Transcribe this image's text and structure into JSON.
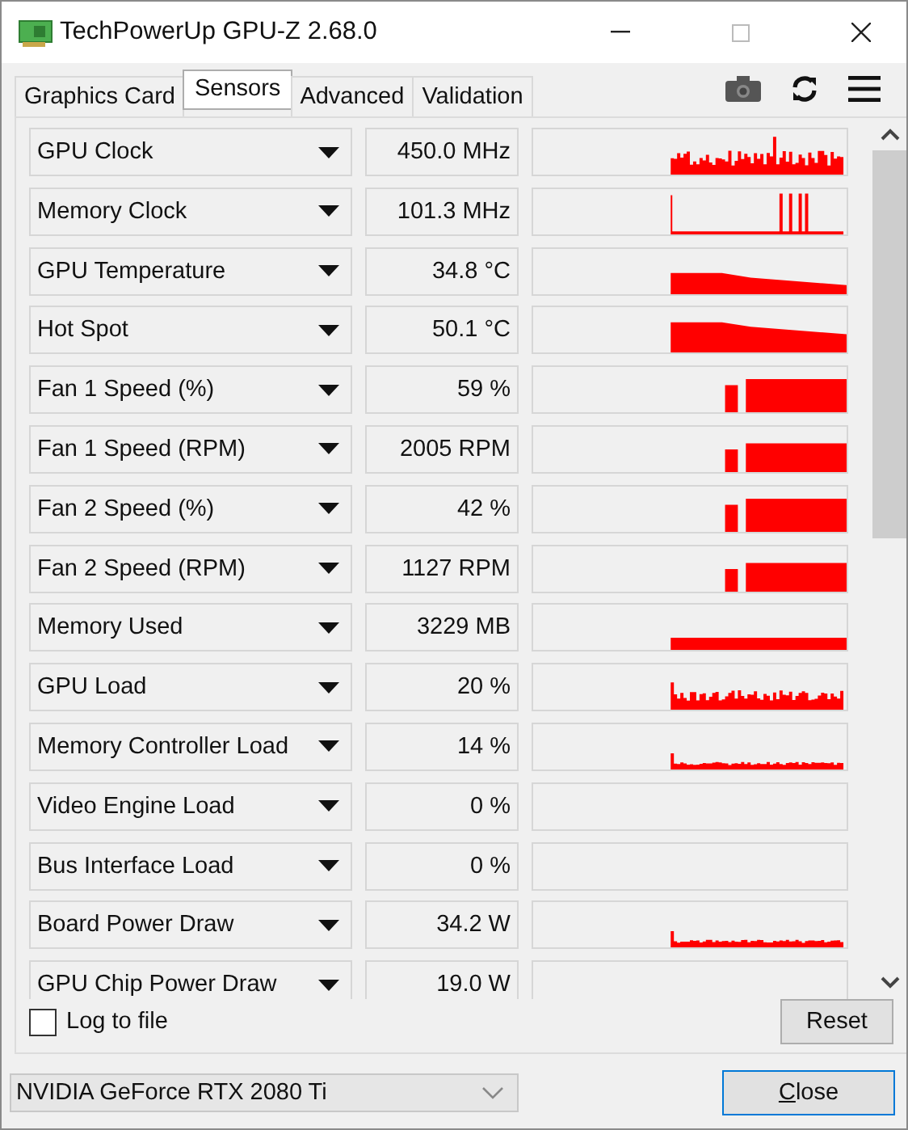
{
  "window": {
    "title": "TechPowerUp GPU-Z 2.68.0"
  },
  "tabs": [
    {
      "label": "Graphics Card",
      "selected": false
    },
    {
      "label": "Sensors",
      "selected": true
    },
    {
      "label": "Advanced",
      "selected": false
    },
    {
      "label": "Validation",
      "selected": false
    }
  ],
  "sensors": [
    {
      "name": "GPU Clock",
      "value": "450.0 MHz",
      "kind": "spiky"
    },
    {
      "name": "Memory Clock",
      "value": "101.3 MHz",
      "kind": "sparse"
    },
    {
      "name": "GPU Temperature",
      "value": "34.8 °C",
      "kind": "falling"
    },
    {
      "name": "Hot Spot",
      "value": "50.1 °C",
      "kind": "falling"
    },
    {
      "name": "Fan 1 Speed (%)",
      "value": "59 %",
      "kind": "step"
    },
    {
      "name": "Fan 1 Speed (RPM)",
      "value": "2005 RPM",
      "kind": "step"
    },
    {
      "name": "Fan 2 Speed (%)",
      "value": "42 %",
      "kind": "step"
    },
    {
      "name": "Fan 2 Speed (RPM)",
      "value": "1127 RPM",
      "kind": "step"
    },
    {
      "name": "Memory Used",
      "value": "3229 MB",
      "kind": "flat"
    },
    {
      "name": "GPU Load",
      "value": "20 %",
      "kind": "noisy"
    },
    {
      "name": "Memory Controller Load",
      "value": "14 %",
      "kind": "low"
    },
    {
      "name": "Video Engine Load",
      "value": "0 %",
      "kind": "empty"
    },
    {
      "name": "Bus Interface Load",
      "value": "0 %",
      "kind": "empty"
    },
    {
      "name": "Board Power Draw",
      "value": "34.2 W",
      "kind": "low"
    },
    {
      "name": "GPU Chip Power Draw",
      "value": "19.0 W",
      "kind": "empty"
    }
  ],
  "log_to_file": {
    "label": "Log to file",
    "checked": false
  },
  "reset_button": "Reset",
  "gpu_select": {
    "value": "NVIDIA GeForce RTX 2080 Ti"
  },
  "close_button": "Close"
}
